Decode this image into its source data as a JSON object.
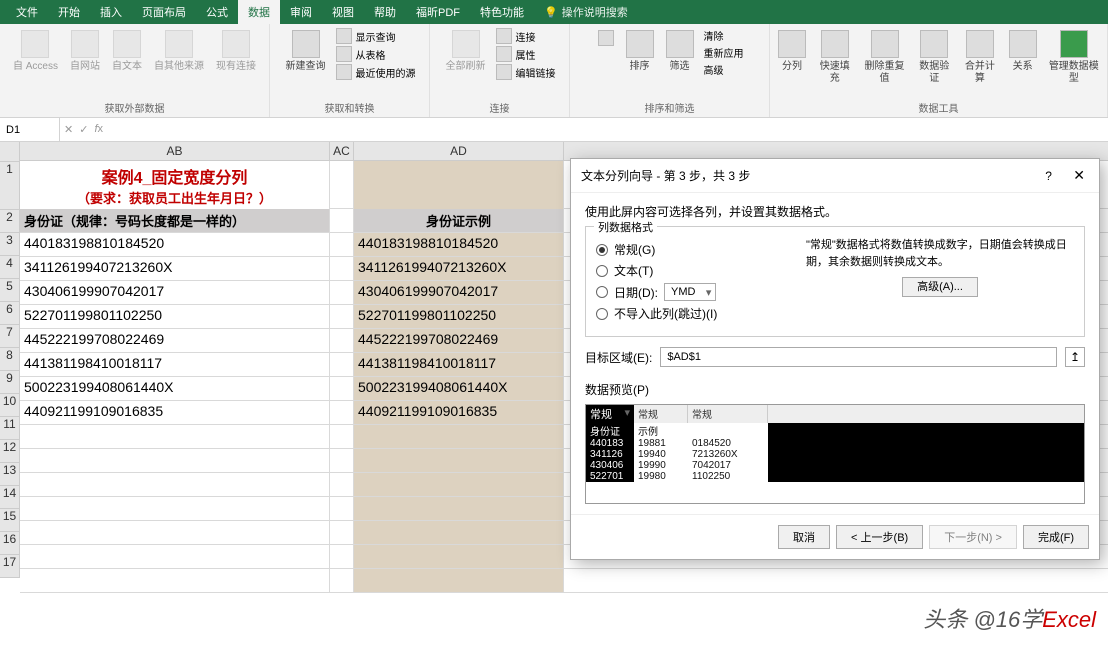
{
  "tabs": [
    "文件",
    "开始",
    "插入",
    "页面布局",
    "公式",
    "数据",
    "审阅",
    "视图",
    "帮助",
    "福昕PDF",
    "特色功能"
  ],
  "active_tab": "数据",
  "tell_me": "操作说明搜索",
  "ribbon": {
    "g1": {
      "label": "获取外部数据",
      "items": [
        "自 Access",
        "自网站",
        "自文本",
        "自其他来源",
        "现有连接"
      ]
    },
    "g2": {
      "label": "获取和转换",
      "btn": "新建查询",
      "sub": [
        "显示查询",
        "从表格",
        "最近使用的源"
      ]
    },
    "g3": {
      "label": "连接",
      "btn": "全部刷新",
      "sub": [
        "连接",
        "属性",
        "编辑链接"
      ]
    },
    "g4": {
      "label": "排序和筛选",
      "b1": "排序",
      "b2": "筛选",
      "sub": [
        "清除",
        "重新应用",
        "高级"
      ]
    },
    "g5": {
      "label": "数据工具",
      "items": [
        "分列",
        "快速填充",
        "删除重复值",
        "数据验证",
        "合并计算",
        "关系",
        "管理数据模型"
      ]
    }
  },
  "namebox": "D1",
  "cols": {
    "AB": "AB",
    "AC": "AC",
    "AD": "AD"
  },
  "sheet": {
    "title": "案例4_固定宽度分列",
    "subtitle": "（要求：获取员工出生年月日？）",
    "hdr_ab": "身份证（规律：号码长度都是一样的）",
    "hdr_ad": "身份证示例",
    "rows": [
      "440183198810184520",
      "341126199407213260X",
      "430406199907042017",
      "522701199801102250",
      "445222199708022469",
      "441381198410018117",
      "500223199408061440X",
      "440921199109016835"
    ],
    "rows_ad": [
      "440183198810184520",
      "341126199407213260X",
      "430406199907042017",
      "522701199801102250",
      "445222199708022469",
      "441381198410018117",
      "500223199408061440X",
      "440921199109016835"
    ]
  },
  "dialog": {
    "title": "文本分列向导 - 第 3 步，共 3 步",
    "help": "?",
    "desc": "使用此屏内容可选择各列，并设置其数据格式。",
    "group_label": "列数据格式",
    "r1": "常规(G)",
    "r2": "文本(T)",
    "r3": "日期(D):",
    "r3v": "YMD",
    "r4": "不导入此列(跳过)(I)",
    "info": "\"常规\"数据格式将数值转换成数字，日期值会转换成日期，其余数据则转换成文本。",
    "adv": "高级(A)...",
    "dest_label": "目标区域(E):",
    "dest_value": "$AD$1",
    "preview_label": "数据预览(P)",
    "ph": [
      "常规",
      "常规",
      "常规"
    ],
    "prows": [
      [
        "身份证",
        "示例",
        ""
      ],
      [
        "440183",
        "19881",
        "0184520"
      ],
      [
        "341126",
        "19940",
        "7213260X"
      ],
      [
        "430406",
        "19990",
        "7042017"
      ],
      [
        "522701",
        "19980",
        "1102250"
      ]
    ],
    "btns": {
      "cancel": "取消",
      "back": "< 上一步(B)",
      "next": "下一步(N) >",
      "finish": "完成(F)"
    }
  },
  "watermark": {
    "t1": "头条 @16学",
    "t2": "Excel"
  }
}
